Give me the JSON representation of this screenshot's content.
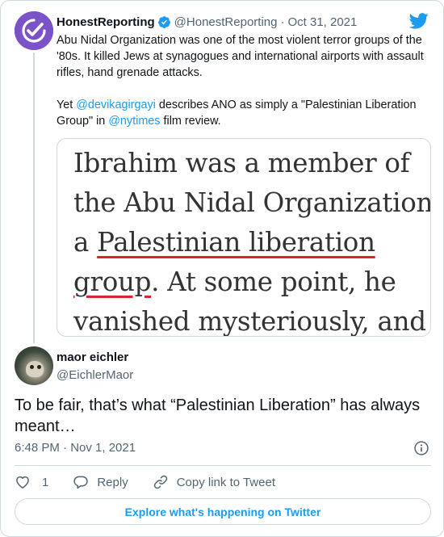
{
  "parent_tweet": {
    "author_name": "HonestReporting",
    "handle": "@HonestReporting",
    "separator": "·",
    "date": "Oct 31, 2021",
    "text_line1": "Abu Nidal Organization was one of the most violent terror groups of the '80s. It killed Jews at synagogues and international airports with assault rifles, hand grenade attacks.",
    "text_line2_prefix": "Yet ",
    "mention1": "@devikagirgayi",
    "text_line2_middle": " describes ANO as simply a \"Palestinian Liberation Group\" in ",
    "mention2": "@nytimes",
    "text_line2_suffix": " film review.",
    "media_quote": {
      "line1": "Ibrahim was a member of",
      "line2": "the Abu Nidal Organization,",
      "line3_prefix": "a ",
      "line3_underlined": "Palestinian liberation",
      "line4_underlined": "group",
      "line4_suffix": ". At some point, he",
      "line5": "vanished mysteriously, and"
    }
  },
  "reply_tweet": {
    "author_name": "maor eichler",
    "handle": "@EichlerMaor",
    "text": "To be fair, that’s what “Palestinian Liberation” has always meant…",
    "timestamp": "6:48 PM · Nov 1, 2021"
  },
  "actions": {
    "like_count": "1",
    "reply_label": "Reply",
    "copy_link_label": "Copy link to Tweet"
  },
  "explore_label": "Explore what's happening on Twitter",
  "colors": {
    "accent": "#1d9bf0",
    "secondary_text": "#536471",
    "border": "#cfd9de",
    "avatar_purple": "#7b52c7",
    "underline_red": "#d8262a"
  },
  "icons": [
    "checkmark-logo-icon",
    "verified-badge-icon",
    "twitter-bird-icon",
    "info-icon",
    "heart-icon",
    "reply-icon",
    "link-icon"
  ]
}
